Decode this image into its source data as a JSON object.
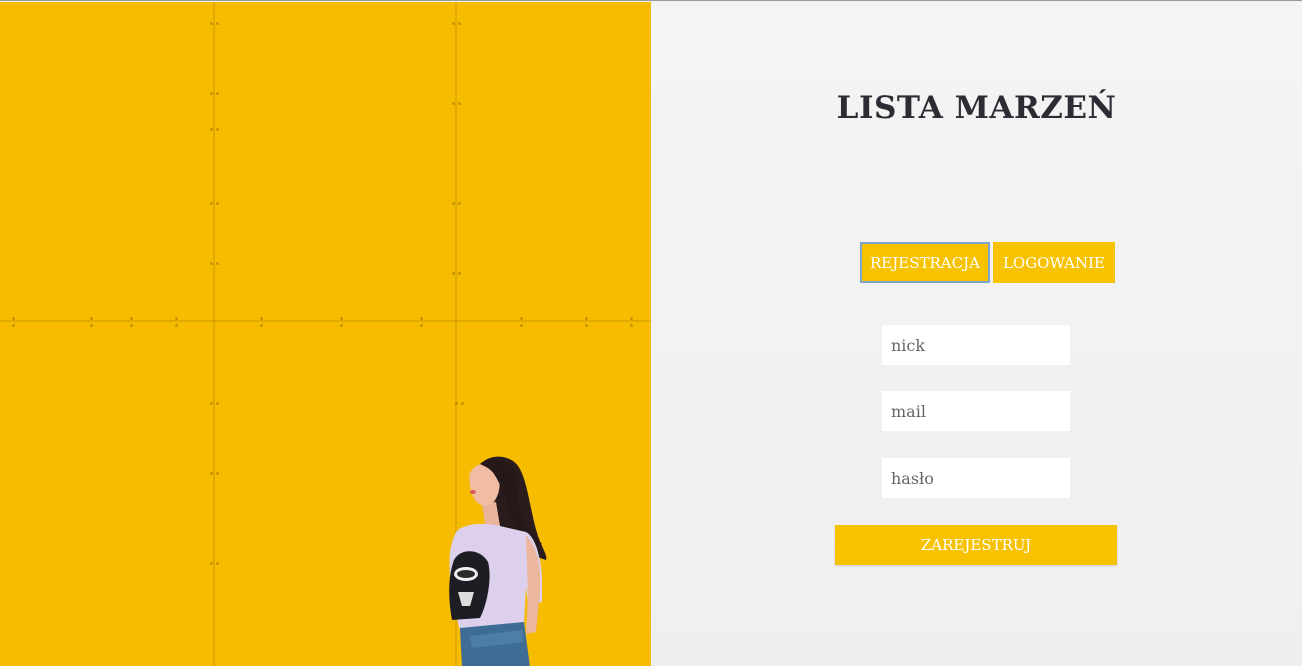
{
  "app": {
    "title": "LISTA MARZEŃ"
  },
  "colors": {
    "accent": "#f7c200",
    "hero_background": "#f7bb00",
    "panel_background": "#f1f1f1",
    "active_tab_border": "#7fa6c9"
  },
  "tabs": [
    {
      "label": "REJESTRACJA",
      "active": true
    },
    {
      "label": "LOGOWANIE",
      "active": false
    }
  ],
  "form": {
    "nick_placeholder": "nick",
    "mail_placeholder": "mail",
    "password_placeholder": "hasło",
    "submit_label": "ZAREJESTRUJ"
  }
}
